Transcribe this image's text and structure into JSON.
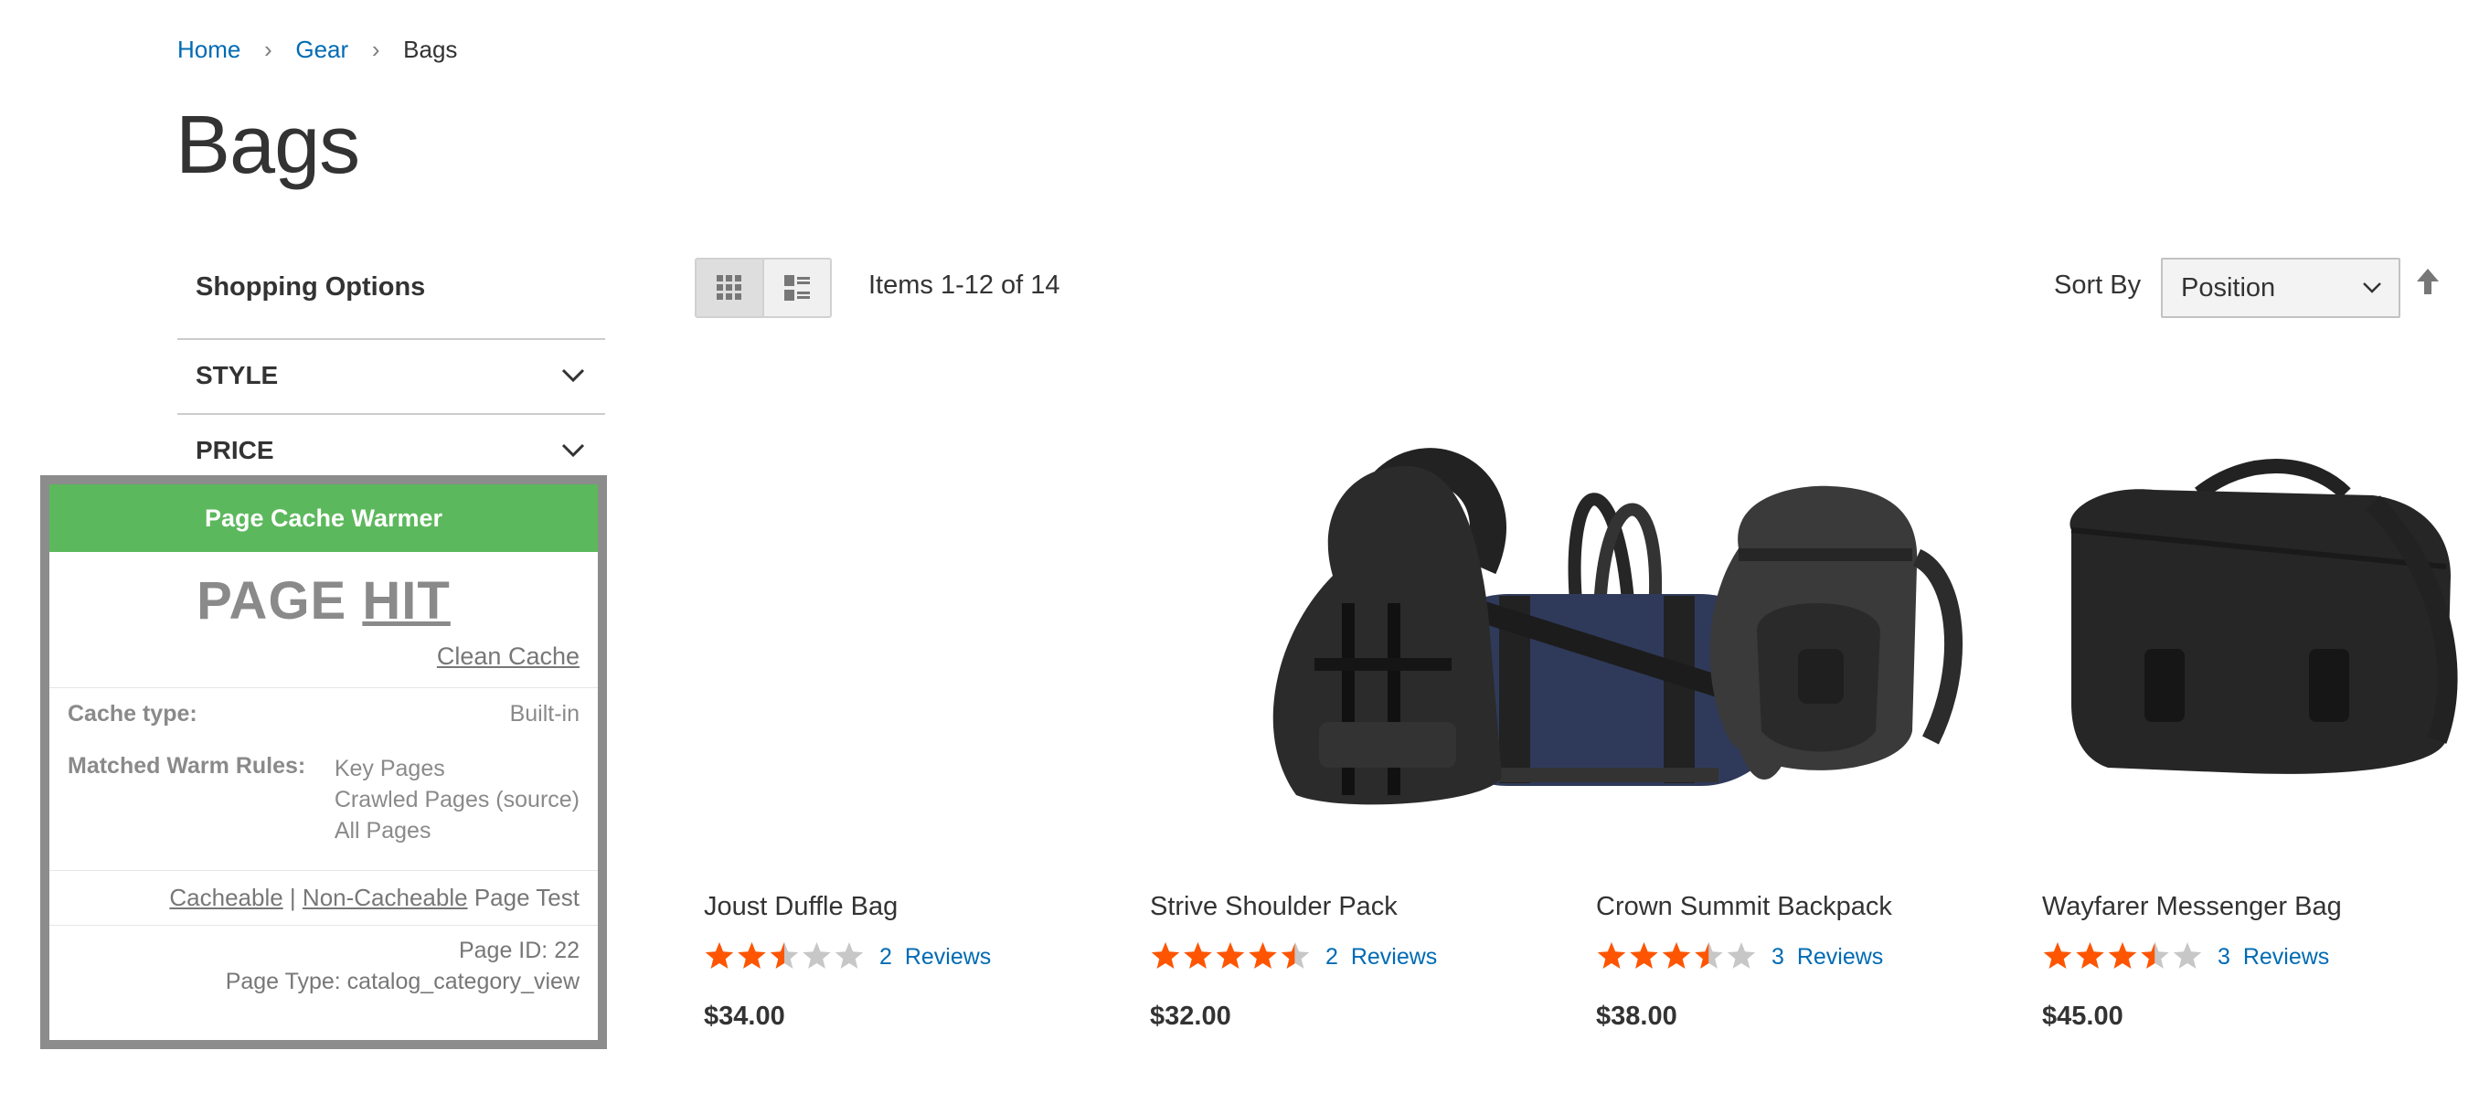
{
  "breadcrumb": {
    "home": "Home",
    "gear": "Gear",
    "current": "Bags",
    "separator": "›"
  },
  "page_title": "Bags",
  "sidebar": {
    "title": "Shopping Options",
    "filters": [
      {
        "label": "STYLE"
      },
      {
        "label": "PRICE"
      }
    ]
  },
  "cache_warmer": {
    "header": "Page Cache Warmer",
    "status_prefix": "PAGE",
    "status_word": "HIT",
    "clean_label": "Clean Cache",
    "cache_type_label": "Cache type:",
    "cache_type_value": "Built-in",
    "matched_rules_label": "Matched Warm Rules:",
    "matched_rules": [
      "Key Pages",
      "Crawled Pages (source)",
      "All Pages"
    ],
    "cacheable_label": "Cacheable",
    "pipe": "|",
    "non_cacheable_label": "Non-Cacheable",
    "page_test_label": "Page Test",
    "page_id": "Page ID: 22",
    "page_type": "Page Type: catalog_category_view",
    "header_color": "#5cb85c"
  },
  "toolbar": {
    "amount": "Items 1-12 of 14",
    "sort_label": "Sort By",
    "sort_value": "Position",
    "grid_icon": "grid-view-icon",
    "list_icon": "list-view-icon",
    "sort_direction_icon": "sort-ascending-arrow-icon"
  },
  "products": [
    {
      "name": "Joust Duffle Bag",
      "rating": 2.5,
      "reviews_count": "2",
      "reviews_label": "Reviews",
      "price": "$34.00"
    },
    {
      "name": "Strive Shoulder Pack",
      "rating": 4.5,
      "reviews_count": "2",
      "reviews_label": "Reviews",
      "price": "$32.00"
    },
    {
      "name": "Crown Summit Backpack",
      "rating": 3.5,
      "reviews_count": "3",
      "reviews_label": "Reviews",
      "price": "$38.00"
    },
    {
      "name": "Wayfarer Messenger Bag",
      "rating": 3.5,
      "reviews_count": "3",
      "reviews_label": "Reviews",
      "price": "$45.00"
    }
  ],
  "colors": {
    "link": "#006bb4",
    "star": "#ff5501",
    "star_empty": "#c7c7c7"
  }
}
